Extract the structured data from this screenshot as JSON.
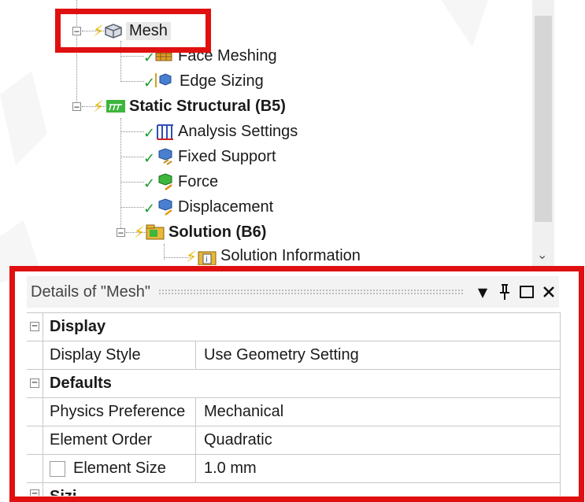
{
  "tree": {
    "nodes": [
      {
        "label": "Mesh"
      },
      {
        "label": "Face Meshing"
      },
      {
        "label": "Edge Sizing"
      },
      {
        "label": "Static Structural (B5)"
      },
      {
        "label": "Analysis Settings"
      },
      {
        "label": "Fixed Support"
      },
      {
        "label": "Force"
      },
      {
        "label": "Displacement"
      },
      {
        "label": "Solution (B6)"
      },
      {
        "label": "Solution Information"
      }
    ]
  },
  "details": {
    "title": "Details of \"Mesh\"",
    "sections": [
      {
        "name": "Display"
      },
      {
        "name": "Defaults"
      },
      {
        "name": "Sizi"
      }
    ],
    "rows": [
      {
        "name": "Display Style",
        "value": "Use Geometry Setting"
      },
      {
        "name": "Physics Preference",
        "value": "Mechanical"
      },
      {
        "name": "Element Order",
        "value": "Quadratic"
      },
      {
        "name": "Element Size",
        "value": "1.0 mm"
      }
    ]
  },
  "colors": {
    "highlight": "#e01010",
    "check": "#1a9b2a",
    "bolt": "#e6b800"
  }
}
